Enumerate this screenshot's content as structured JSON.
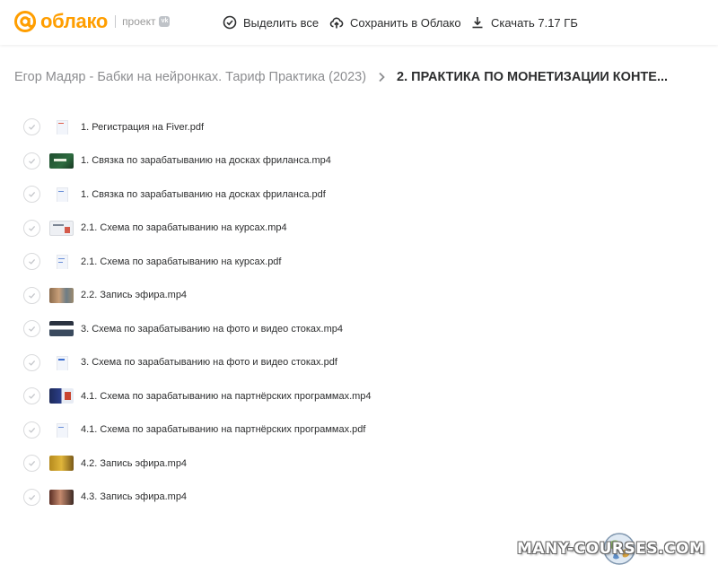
{
  "header": {
    "logo_text": "облако",
    "logo_sub": "проект",
    "vk_badge": "vk",
    "actions": [
      {
        "label": "Выделить все",
        "icon": "check-circle-icon"
      },
      {
        "label": "Сохранить в Облако",
        "icon": "cloud-upload-icon"
      },
      {
        "label": "Скачать 7.17 ГБ",
        "icon": "download-icon"
      }
    ],
    "brand_color": "#ff9e00"
  },
  "breadcrumb": {
    "parent": "Егор Мадяр - Бабки на нейронках. Тариф Практика (2023)",
    "current": "2. ПРАКТИКА ПО МОНЕТИЗАЦИИ КОНТЕ..."
  },
  "files": [
    {
      "name": "1. Регистрация на Fiver.pdf",
      "type": "pdf"
    },
    {
      "name": "1. Связка по зарабатыванию на досках фриланса.mp4",
      "type": "video"
    },
    {
      "name": "1. Связка по зарабатыванию на досках фриланса.pdf",
      "type": "pdf"
    },
    {
      "name": "2.1. Схема по зарабатыванию на курсах.mp4",
      "type": "video"
    },
    {
      "name": "2.1. Схема по зарабатыванию на курсах.pdf",
      "type": "pdf"
    },
    {
      "name": "2.2. Запись эфира.mp4",
      "type": "video"
    },
    {
      "name": "3. Схема по зарабатыванию на фото и видео стоках.mp4",
      "type": "video"
    },
    {
      "name": "3. Схема по зарабатыванию на фото и видео стоках.pdf",
      "type": "pdf"
    },
    {
      "name": "4.1. Схема по зарабатыванию на партнёрских программах.mp4",
      "type": "video"
    },
    {
      "name": "4.1. Схема по зарабатыванию на партнёрских программах.pdf",
      "type": "pdf"
    },
    {
      "name": "4.2. Запись эфира.mp4",
      "type": "video"
    },
    {
      "name": "4.3. Запись эфира.mp4",
      "type": "video"
    }
  ],
  "watermark": "MANY-COURSES.COM"
}
